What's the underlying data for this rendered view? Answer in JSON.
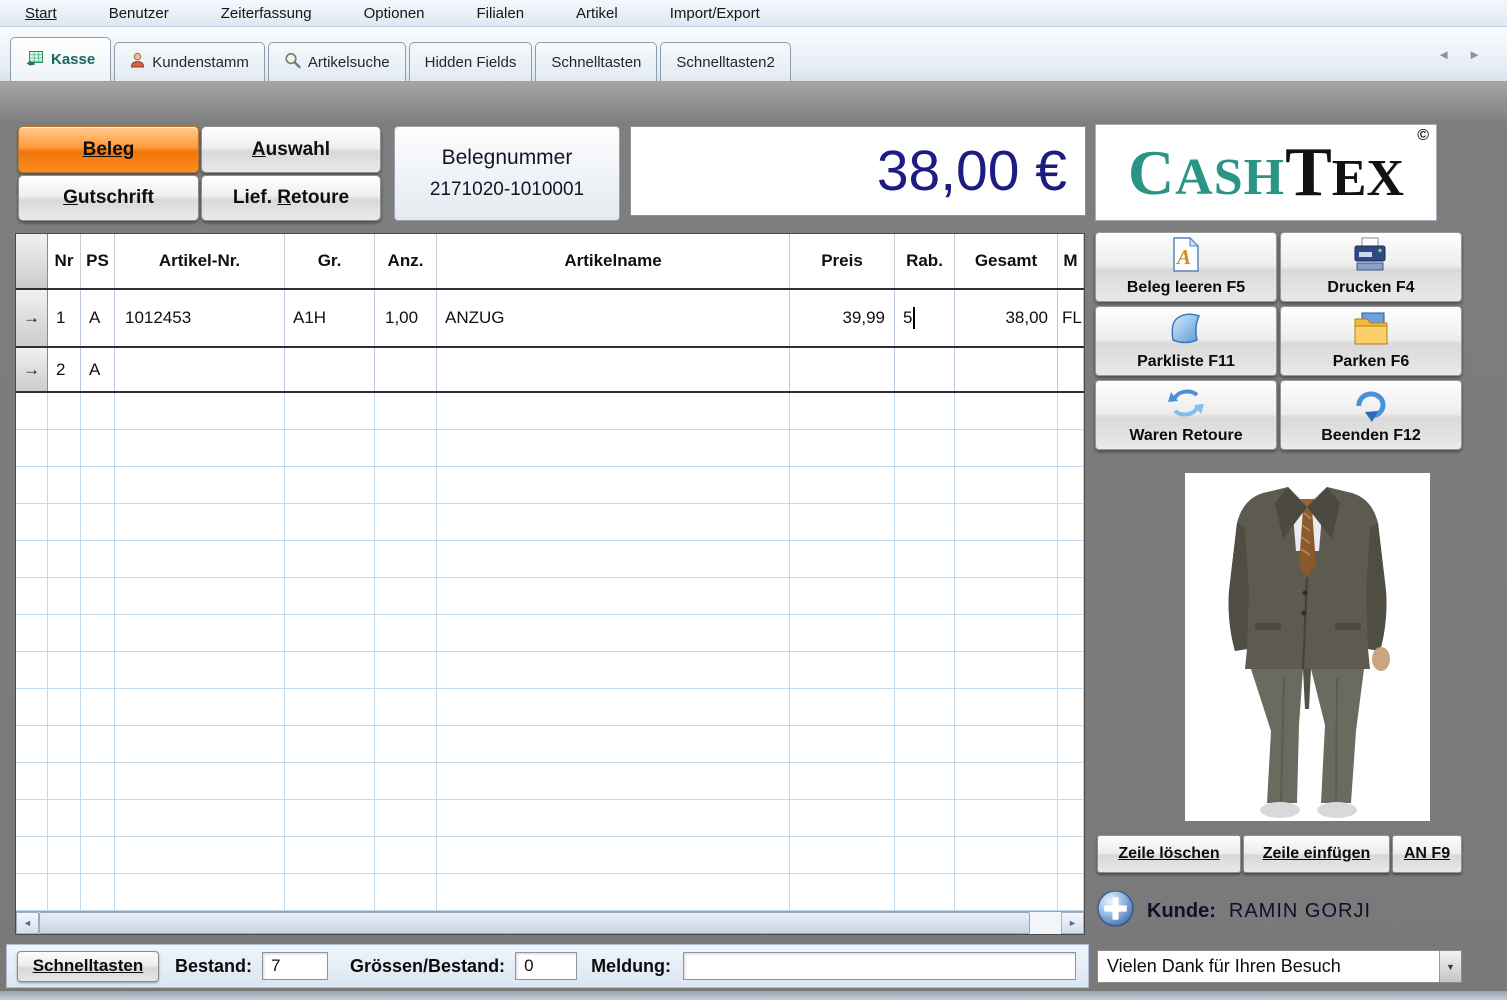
{
  "colors": {
    "accent_orange": "#f98a1e",
    "total_navy": "#1c1c82",
    "logo_teal": "#2a9486",
    "grid_blue": "#c4d8ec"
  },
  "icons": {
    "row_pointer": "→",
    "scroll_left": "◄",
    "scroll_right": "►",
    "tab_left": "◄",
    "tab_right": "►",
    "dropdown_arrow": "▼"
  },
  "menubar": {
    "items": [
      "Start",
      "Benutzer",
      "Zeiterfassung",
      "Optionen",
      "Filialen",
      "Artikel",
      "Import/Export"
    ]
  },
  "tabs": [
    {
      "label": "Kasse"
    },
    {
      "label": "Kundenstamm"
    },
    {
      "label": "Artikelsuche"
    },
    {
      "label": "Hidden Fields"
    },
    {
      "label": "Schnelltasten"
    },
    {
      "label": "Schnelltasten2"
    }
  ],
  "doc_buttons": {
    "beleg": {
      "pre": "",
      "key": "Beleg",
      "post": ""
    },
    "auswahl": {
      "pre": "",
      "key": "A",
      "post": "uswahl"
    },
    "gutschrift": {
      "pre": "",
      "key": "G",
      "post": "utschrift"
    },
    "lief_retoure": {
      "pre": "Lief. ",
      "key": "R",
      "post": "etoure"
    }
  },
  "beleg_info": {
    "label": "Belegnummer",
    "number": "2171020-1010001"
  },
  "total": "38,00 €",
  "logo": {
    "part1": "CASH",
    "part2": "TEX",
    "copyright": "©"
  },
  "table": {
    "headers": [
      "Nr",
      "PS",
      "Artikel-Nr.",
      "Gr.",
      "Anz.",
      "Artikelname",
      "Preis",
      "Rab.",
      "Gesamt",
      "M"
    ],
    "rows": [
      {
        "nr": "1",
        "ps": "A",
        "artikel_nr": "1012453",
        "gr": "A1H",
        "anz": "1,00",
        "name": "ANZUG",
        "preis": "39,99",
        "rab": "5",
        "gesamt": "38,00",
        "m": "FL"
      },
      {
        "nr": "2",
        "ps": "A",
        "artikel_nr": "",
        "gr": "",
        "anz": "",
        "name": "",
        "preis": "",
        "rab": "",
        "gesamt": "",
        "m": ""
      }
    ]
  },
  "actions": {
    "beleg_leeren": "Beleg leeren F5",
    "drucken": "Drucken F4",
    "parkliste": "Parkliste F11",
    "parken": "Parken F6",
    "waren_retoure": "Waren Retoure",
    "beenden": "Beenden  F12"
  },
  "row_actions": {
    "zeile_loeschen": "Zeile löschen",
    "zeile_einfuegen": "Zeile einfügen",
    "an_f9": "AN F9"
  },
  "customer": {
    "label": "Kunde:",
    "name": "RAMIN GORJI"
  },
  "farewell": "Vielen Dank für Ihren Besuch",
  "statusbar": {
    "schnelltasten": "Schnelltasten",
    "bestand_label": "Bestand:",
    "bestand_value": "7",
    "groessen_label": "Grössen/Bestand:",
    "groessen_value": "0",
    "meldung_label": "Meldung:",
    "meldung_value": ""
  }
}
